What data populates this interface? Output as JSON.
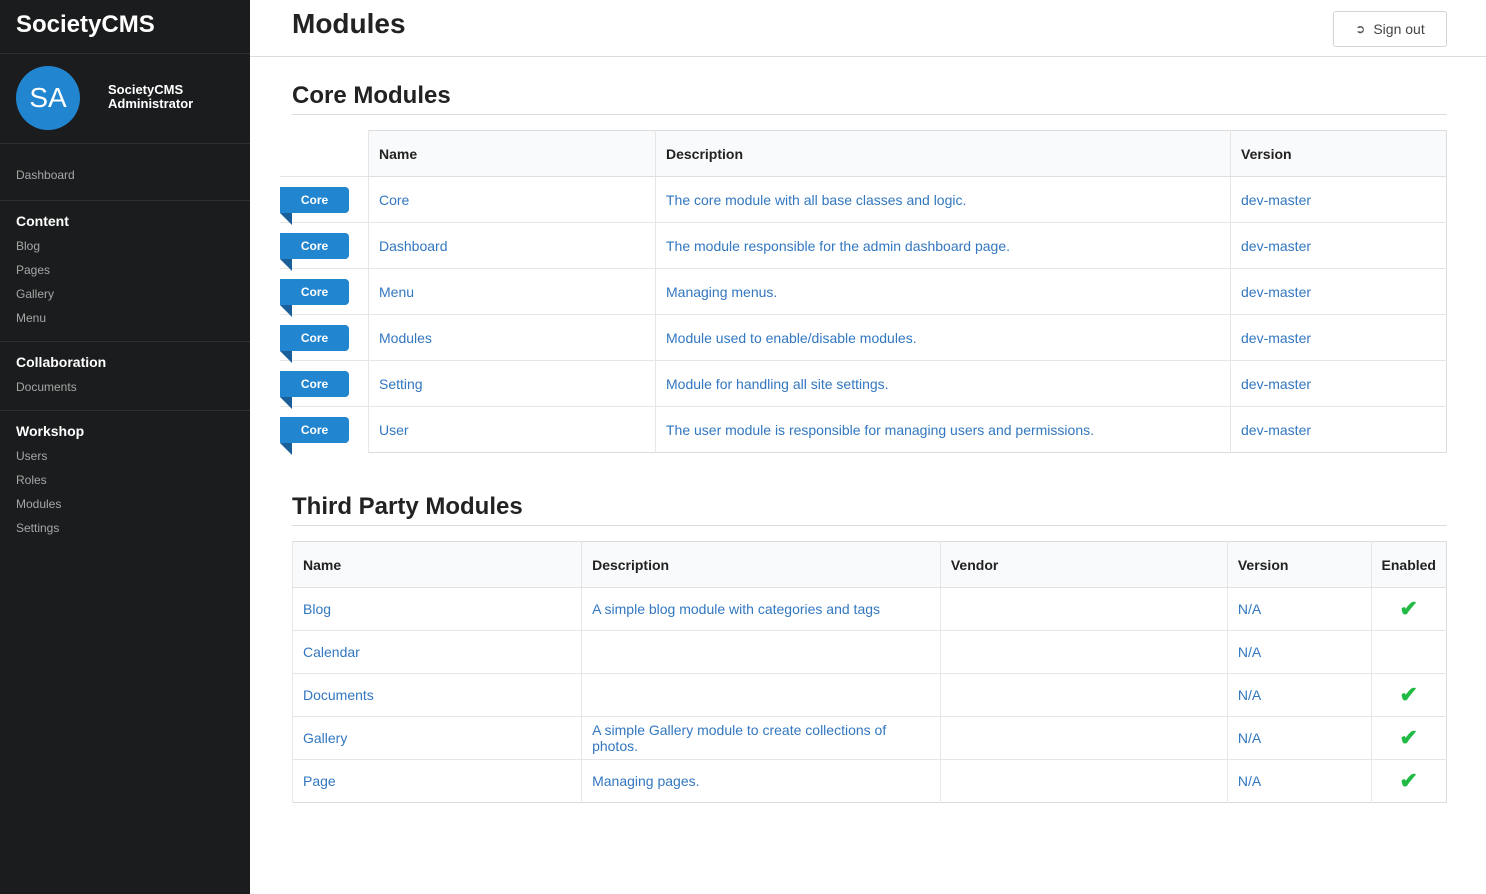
{
  "sidebar": {
    "brand": "SocietyCMS",
    "avatar_initials": "SA",
    "profile_name": "SocietyCMS Administrator",
    "dashboard_label": "Dashboard",
    "groups": [
      {
        "title": "Content",
        "items": [
          "Blog",
          "Pages",
          "Gallery",
          "Menu"
        ]
      },
      {
        "title": "Collaboration",
        "items": [
          "Documents"
        ]
      },
      {
        "title": "Workshop",
        "items": [
          "Users",
          "Roles",
          "Modules",
          "Settings"
        ]
      }
    ]
  },
  "header": {
    "title": "Modules",
    "signout_label": "Sign out"
  },
  "core": {
    "title": "Core Modules",
    "columns": [
      "Name",
      "Description",
      "Version"
    ],
    "badge": "Core",
    "rows": [
      {
        "name": "Core",
        "description": "The core module with all base classes and logic.",
        "version": "dev-master"
      },
      {
        "name": "Dashboard",
        "description": "The module responsible for the admin dashboard page.",
        "version": "dev-master"
      },
      {
        "name": "Menu",
        "description": "Managing menus.",
        "version": "dev-master"
      },
      {
        "name": "Modules",
        "description": "Module used to enable/disable modules.",
        "version": "dev-master"
      },
      {
        "name": "Setting",
        "description": "Module for handling all site settings.",
        "version": "dev-master"
      },
      {
        "name": "User",
        "description": "The user module is responsible for managing users and permissions.",
        "version": "dev-master"
      }
    ]
  },
  "third_party": {
    "title": "Third Party Modules",
    "columns": [
      "Name",
      "Description",
      "Vendor",
      "Version",
      "Enabled"
    ],
    "rows": [
      {
        "name": "Blog",
        "description": "A simple blog module with categories and tags",
        "vendor": "",
        "version": "N/A",
        "enabled": true
      },
      {
        "name": "Calendar",
        "description": "",
        "vendor": "",
        "version": "N/A",
        "enabled": false
      },
      {
        "name": "Documents",
        "description": "",
        "vendor": "",
        "version": "N/A",
        "enabled": true
      },
      {
        "name": "Gallery",
        "description": "A simple Gallery module to create collections of photos.",
        "vendor": "",
        "version": "N/A",
        "enabled": true
      },
      {
        "name": "Page",
        "description": "Managing pages.",
        "vendor": "",
        "version": "N/A",
        "enabled": true
      }
    ]
  },
  "colors": {
    "accent": "#2185d0",
    "link": "#3277c0",
    "check": "#21ba45",
    "sidebar_bg": "#1b1c1d"
  }
}
